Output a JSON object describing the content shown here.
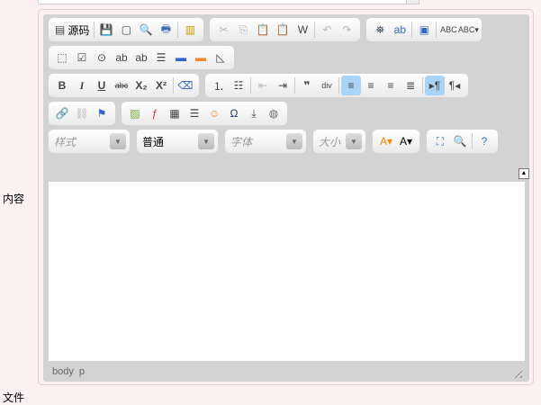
{
  "form": {
    "content_label": "内容",
    "next_label": "文件"
  },
  "toolbar": {
    "rows": [
      [
        [
          {
            "n": "source",
            "g": "▤",
            "label": "源码"
          },
          {
            "sep": 1
          },
          {
            "n": "save",
            "g": "💾",
            "c": "#3b6fb6"
          },
          {
            "n": "new-page",
            "g": "▢"
          },
          {
            "n": "preview",
            "g": "🔍"
          },
          {
            "n": "print",
            "g": "🖶",
            "c": "#3b6fb6"
          },
          {
            "sep": 1
          },
          {
            "n": "templates",
            "g": "▥",
            "c": "#c90"
          }
        ],
        [
          {
            "n": "cut",
            "g": "✂",
            "d": 1
          },
          {
            "n": "copy",
            "g": "⎘",
            "d": 1
          },
          {
            "n": "paste",
            "g": "📋"
          },
          {
            "n": "paste-text",
            "g": "📋"
          },
          {
            "n": "paste-word",
            "g": "W"
          },
          {
            "sep": 1
          },
          {
            "n": "undo",
            "g": "↶",
            "d": 1
          },
          {
            "n": "redo",
            "g": "↷",
            "d": 1
          }
        ],
        [
          {
            "n": "find",
            "g": "⛯",
            "c": "#345"
          },
          {
            "n": "replace",
            "g": "ab",
            "c": "#36c"
          },
          {
            "sep": 1
          },
          {
            "n": "select-all",
            "g": "▣",
            "c": "#36c"
          },
          {
            "sep": 1
          },
          {
            "n": "spellcheck",
            "g": "ABC"
          },
          {
            "n": "spellcheck-menu",
            "g": "ABC▾"
          }
        ]
      ],
      [
        [
          {
            "n": "form",
            "g": "⬚"
          },
          {
            "n": "checkbox",
            "g": "☑"
          },
          {
            "n": "radio",
            "g": "⊙"
          },
          {
            "n": "textfield",
            "g": "ab"
          },
          {
            "n": "textarea",
            "g": "ab"
          },
          {
            "n": "select",
            "g": "☰"
          },
          {
            "n": "button",
            "g": "▬",
            "c": "#36c"
          },
          {
            "n": "image-button",
            "g": "▬",
            "c": "#e83"
          },
          {
            "n": "hidden-field",
            "g": "◺"
          }
        ]
      ],
      [
        [
          {
            "n": "bold",
            "g": "B",
            "b": 1
          },
          {
            "n": "italic",
            "g": "I",
            "i": 1
          },
          {
            "n": "underline",
            "g": "U",
            "u": 1
          },
          {
            "n": "strike",
            "g": "abc",
            "s": 1
          },
          {
            "n": "subscript",
            "g": "X₂",
            "b": 1
          },
          {
            "n": "superscript",
            "g": "X²",
            "b": 1
          },
          {
            "sep": 1
          },
          {
            "n": "remove-format",
            "g": "⌫",
            "c": "#36c"
          }
        ],
        [
          {
            "n": "numbered-list",
            "g": "⒈"
          },
          {
            "n": "bulleted-list",
            "g": "☷"
          },
          {
            "sep": 1
          },
          {
            "n": "outdent",
            "g": "⇤",
            "d": 1
          },
          {
            "n": "indent",
            "g": "⇥"
          },
          {
            "sep": 1
          },
          {
            "n": "blockquote",
            "g": "❞",
            "b": 1
          },
          {
            "n": "div",
            "g": "div"
          },
          {
            "sep": 1
          },
          {
            "n": "align-left",
            "g": "≡",
            "on": 1
          },
          {
            "n": "align-center",
            "g": "≡"
          },
          {
            "n": "align-right",
            "g": "≡"
          },
          {
            "n": "justify",
            "g": "≣"
          },
          {
            "sep": 1
          },
          {
            "n": "ltr",
            "g": "▸¶",
            "on": 1
          },
          {
            "n": "rtl",
            "g": "¶◂"
          }
        ]
      ],
      [
        [
          {
            "n": "link",
            "g": "🔗",
            "c": "#275"
          },
          {
            "n": "unlink",
            "g": "⛓",
            "d": 1
          },
          {
            "n": "anchor",
            "g": "⚑",
            "c": "#36c"
          }
        ],
        [
          {
            "n": "image",
            "g": "▨",
            "c": "#7a3"
          },
          {
            "n": "flash",
            "g": "ƒ",
            "c": "#c33"
          },
          {
            "n": "table",
            "g": "▦"
          },
          {
            "n": "horizontal-rule",
            "g": "☰"
          },
          {
            "n": "smiley",
            "g": "☺",
            "c": "#e80"
          },
          {
            "n": "special-char",
            "g": "Ω",
            "c": "#236"
          },
          {
            "n": "page-break",
            "g": "⤓"
          },
          {
            "n": "iframe",
            "g": "◍",
            "c": "#667"
          }
        ]
      ]
    ],
    "combos": {
      "styles": "样式",
      "format": "普通",
      "font": "字体",
      "size": "大小"
    },
    "last_row_tail": [
      [
        {
          "n": "text-color",
          "g": "A▾",
          "c": "#e80"
        },
        {
          "n": "bg-color",
          "g": "A▾",
          "c": "#000"
        }
      ],
      [
        {
          "n": "maximize",
          "g": "⛶",
          "c": "#36c"
        },
        {
          "n": "show-blocks",
          "g": "🔍"
        },
        {
          "sep": 1
        },
        {
          "n": "about",
          "g": "?",
          "c": "#36c"
        }
      ]
    ]
  },
  "status": {
    "path": [
      "body",
      "p"
    ]
  }
}
